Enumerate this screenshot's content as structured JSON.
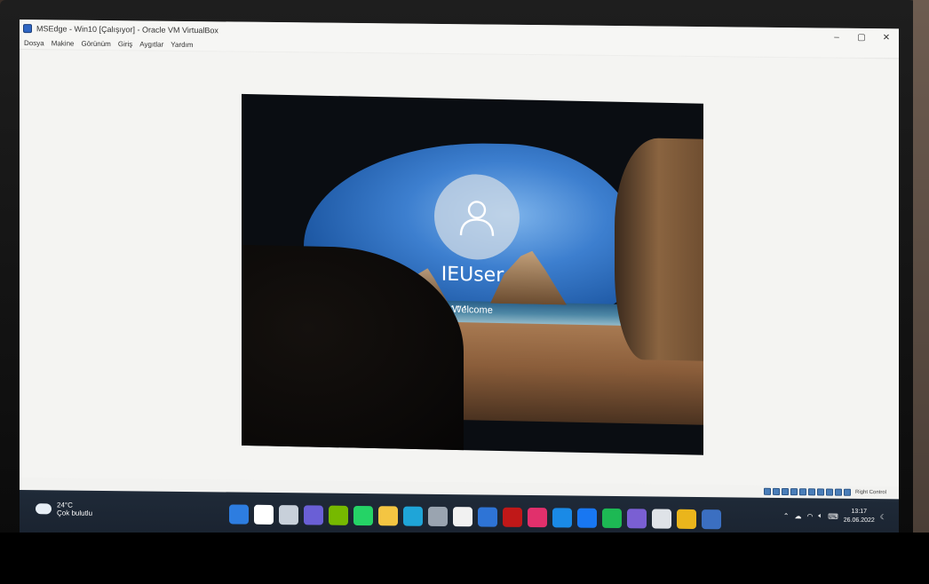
{
  "window": {
    "title": "MSEdge - Win10 [Çalışıyor] - Oracle VM VirtualBox",
    "minimize": "–",
    "maximize": "▢",
    "close": "✕"
  },
  "menu": {
    "items": [
      {
        "label": "Dosya"
      },
      {
        "label": "Makine"
      },
      {
        "label": "Görünüm"
      },
      {
        "label": "Giriş"
      },
      {
        "label": "Aygıtlar"
      },
      {
        "label": "Yardım"
      }
    ]
  },
  "lockscreen": {
    "user_name": "IEUser",
    "status": "Welcome",
    "avatar_icon": "user-icon"
  },
  "statusbar": {
    "host_key": "Right Control"
  },
  "taskbar": {
    "weather": {
      "temp": "24°C",
      "desc": "Çok bulutlu",
      "icon": "cloud-icon"
    },
    "apps": [
      {
        "name": "start-icon",
        "color": "#2d7de0"
      },
      {
        "name": "search-icon",
        "color": "#ffffff"
      },
      {
        "name": "task-view-icon",
        "color": "#c8d0da"
      },
      {
        "name": "teams-chat-icon",
        "color": "#6a5fd6"
      },
      {
        "name": "nvidia-icon",
        "color": "#76b900"
      },
      {
        "name": "whatsapp-icon",
        "color": "#25d366"
      },
      {
        "name": "file-explorer-icon",
        "color": "#f4c542"
      },
      {
        "name": "edge-icon",
        "color": "#1fa5d8"
      },
      {
        "name": "settings-icon",
        "color": "#9aa4b0"
      },
      {
        "name": "calendar-icon",
        "color": "#f1f1f1"
      },
      {
        "name": "azure-icon",
        "color": "#2e74d6"
      },
      {
        "name": "mcafee-icon",
        "color": "#c01818"
      },
      {
        "name": "instagram-icon",
        "color": "#e1306c"
      },
      {
        "name": "mail-icon",
        "color": "#1a8ae6"
      },
      {
        "name": "facebook-icon",
        "color": "#1877f2"
      },
      {
        "name": "spotify-icon",
        "color": "#1db954"
      },
      {
        "name": "visual-studio-icon",
        "color": "#7a5fd3"
      },
      {
        "name": "unity-icon",
        "color": "#dfe3e8"
      },
      {
        "name": "chrome-icon",
        "color": "#eab51c"
      },
      {
        "name": "virtualbox-icon",
        "color": "#3b6fc1"
      }
    ],
    "clock": {
      "time": "13:17",
      "date": "26.06.2022"
    }
  }
}
